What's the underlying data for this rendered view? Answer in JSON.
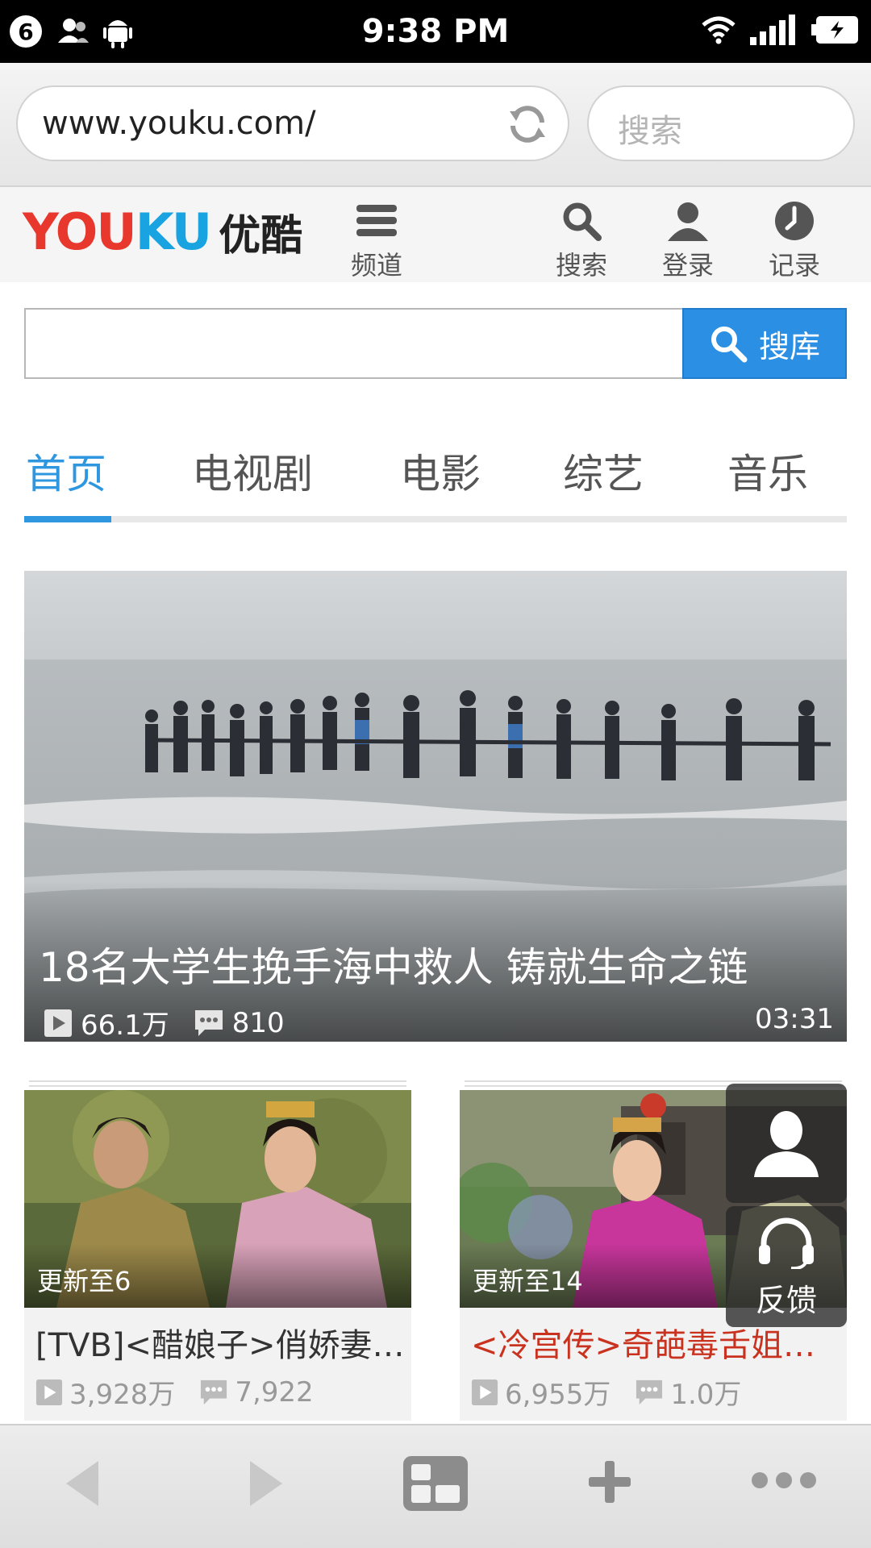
{
  "status_bar": {
    "notification_count": "6",
    "time": "9:38 PM",
    "icons": [
      "notification-count-icon",
      "contacts-icon",
      "android-icon",
      "wifi-icon",
      "signal-icon",
      "battery-icon"
    ]
  },
  "browser": {
    "url": "www.youku.com/",
    "search_placeholder": "搜索"
  },
  "youku_header": {
    "logo_part1": "YOU",
    "logo_part2": "KU",
    "logo_cn": "优酷",
    "channel_label": "频道",
    "search_label": "搜索",
    "login_label": "登录",
    "history_label": "记录"
  },
  "search": {
    "input_value": "",
    "button_label": "搜库"
  },
  "tabs": [
    {
      "label": "首页",
      "active": true
    },
    {
      "label": "电视剧",
      "active": false
    },
    {
      "label": "电影",
      "active": false
    },
    {
      "label": "综艺",
      "active": false
    },
    {
      "label": "音乐",
      "active": false
    }
  ],
  "hero": {
    "title": "18名大学生挽手海中救人 铸就生命之链",
    "plays": "66.1万",
    "comments": "810",
    "duration": "03:31"
  },
  "cards": [
    {
      "update": "更新至6",
      "title": "[TVB]<醋娘子>俏娇妻…",
      "plays": "3,928万",
      "comments": "7,922"
    },
    {
      "update": "更新至14",
      "title": "<冷宫传>奇葩毒舌姐…",
      "plays": "6,955万",
      "comments": "1.0万"
    }
  ],
  "float_panel": {
    "feedback_label": "反馈"
  },
  "colors": {
    "accent_blue": "#2f97e0",
    "youku_red": "#e8382e",
    "youku_blue": "#19a3e1",
    "title_red": "#c9321f"
  }
}
